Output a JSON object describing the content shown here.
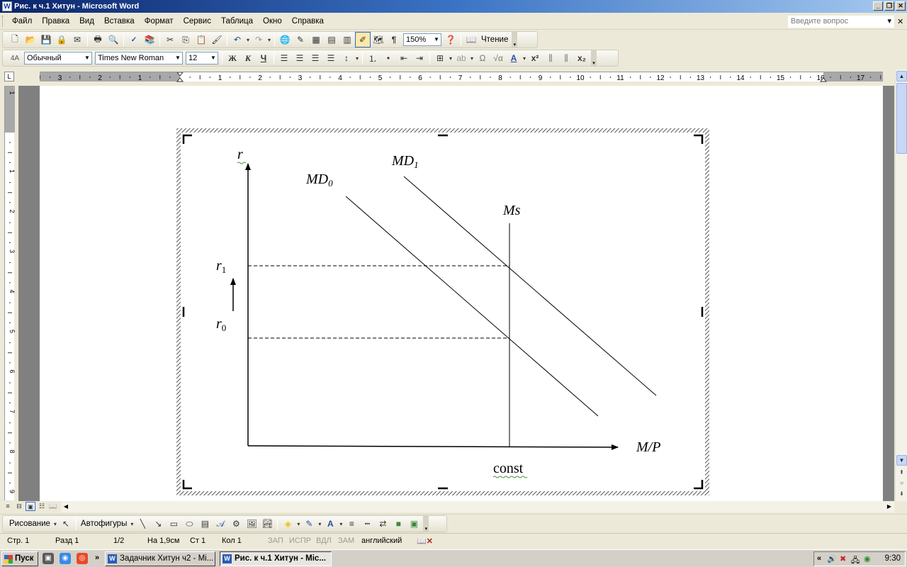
{
  "window": {
    "title": "Рис. к ч.1 Хитун - Microsoft Word",
    "app_icon": "W"
  },
  "menu": {
    "items": [
      "Файл",
      "Правка",
      "Вид",
      "Вставка",
      "Формат",
      "Сервис",
      "Таблица",
      "Окно",
      "Справка"
    ],
    "ask_placeholder": "Введите вопрос"
  },
  "toolbar_standard": {
    "zoom": "150%",
    "reading_label": "Чтение"
  },
  "toolbar_formatting": {
    "style": "Обычный",
    "font": "Times New Roman",
    "size": "12",
    "bold": "Ж",
    "italic": "К",
    "underline": "Ч"
  },
  "ruler": {
    "h_labels": [
      "3",
      "2",
      "1",
      "1",
      "2",
      "3",
      "4",
      "5",
      "6",
      "7",
      "8",
      "9",
      "10",
      "11",
      "12",
      "13",
      "14",
      "15",
      "16",
      "17"
    ],
    "v_labels": [
      "1",
      "1",
      "2",
      "3",
      "4",
      "5",
      "6",
      "7",
      "8",
      "9"
    ]
  },
  "figure": {
    "y_axis": "r",
    "x_axis": "M/P",
    "md0": {
      "base": "MD",
      "sub": "0"
    },
    "md1": {
      "base": "MD",
      "sub": "1"
    },
    "ms": "Ms",
    "r1": {
      "base": "r",
      "sub": "1"
    },
    "r0": {
      "base": "r",
      "sub": "0"
    },
    "const": "const"
  },
  "draw_toolbar": {
    "drawing": "Рисование",
    "autoshapes": "Автофигуры"
  },
  "status": {
    "page": "Стр. 1",
    "section": "Разд 1",
    "pages": "1/2",
    "at": "На 1,9см",
    "line": "Ст 1",
    "col": "Кол 1",
    "rec": "ЗАП",
    "trk": "ИСПР",
    "ext": "ВДЛ",
    "ovr": "ЗАМ",
    "lang": "английский"
  },
  "taskbar": {
    "start": "Пуск",
    "tasks": [
      {
        "label": "Задачник Хитун ч2 - Mi...",
        "active": false
      },
      {
        "label": "Рис. к ч.1 Хитун - Mic...",
        "active": true
      }
    ],
    "more": "»",
    "tray_more": "«",
    "clock": "9:30"
  }
}
